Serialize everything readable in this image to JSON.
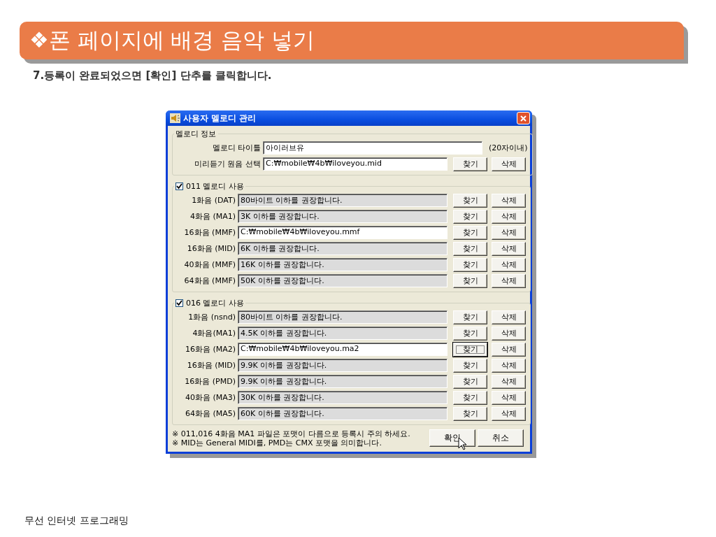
{
  "slide_title": "❖폰 페이지에 배경 음악 넣기",
  "instruction": "7.등록이 완료되었으면 [확인] 단추를 클릭합니다.",
  "dialog": {
    "title": "사용자 멜로디 관리",
    "info_group": {
      "legend": "멜로디 정보",
      "title_label": "멜로디 타이틀",
      "title_value": "아이러브유",
      "title_hint": "(20자이내)",
      "preview_label": "미리듣기 원음 선택",
      "preview_value": "C:₩mobile₩4b₩iloveyou.mid",
      "buttons": [
        "찾기",
        "삭제"
      ]
    },
    "groups": [
      {
        "legend": "011 멜로디 사용",
        "checked": true,
        "rows": [
          {
            "label": "1화음 (DAT)",
            "value": "80바이트 이하를 권장합니다.",
            "disabled": true,
            "buttons": [
              {
                "label": "찾기",
                "focused": false
              },
              {
                "label": "삭제",
                "focused": false
              }
            ]
          },
          {
            "label": "4화음 (MA1)",
            "value": "3K 이하를 권장합니다.",
            "disabled": true,
            "buttons": [
              {
                "label": "찾기",
                "focused": false
              },
              {
                "label": "삭제",
                "focused": false
              }
            ]
          },
          {
            "label": "16화음 (MMF)",
            "value": "C:₩mobile₩4b₩iloveyou.mmf",
            "disabled": false,
            "buttons": [
              {
                "label": "찾기",
                "focused": false
              },
              {
                "label": "삭제",
                "focused": false
              }
            ]
          },
          {
            "label": "16화음 (MID)",
            "value": "6K 이하를 권장합니다.",
            "disabled": true,
            "buttons": [
              {
                "label": "찾기",
                "focused": false
              },
              {
                "label": "삭제",
                "focused": false
              }
            ]
          },
          {
            "label": "40화음 (MMF)",
            "value": "16K 이하를 권장합니다.",
            "disabled": true,
            "buttons": [
              {
                "label": "찾기",
                "focused": false
              },
              {
                "label": "삭제",
                "focused": false
              }
            ]
          },
          {
            "label": "64화음 (MMF)",
            "value": "50K 이하를 권장합니다.",
            "disabled": true,
            "buttons": [
              {
                "label": "찾기",
                "focused": false
              },
              {
                "label": "삭제",
                "focused": false
              }
            ]
          }
        ]
      },
      {
        "legend": "016 멜로디 사용",
        "checked": true,
        "rows": [
          {
            "label": "1화음 (nsnd)",
            "value": "80바이트 이하를 권장합니다.",
            "disabled": true,
            "buttons": [
              {
                "label": "찾기",
                "focused": false
              },
              {
                "label": "삭제",
                "focused": false
              }
            ]
          },
          {
            "label": "4화음(MA1)",
            "value": "4.5K 이하를 권장합니다.",
            "disabled": true,
            "buttons": [
              {
                "label": "찾기",
                "focused": false
              },
              {
                "label": "삭제",
                "focused": false
              }
            ]
          },
          {
            "label": "16화음 (MA2)",
            "value": "C:₩mobile₩4b₩iloveyou.ma2",
            "disabled": false,
            "buttons": [
              {
                "label": "찾기",
                "focused": true
              },
              {
                "label": "삭제",
                "focused": false
              }
            ]
          },
          {
            "label": "16화음 (MID)",
            "value": "9.9K 이하를 권장합니다.",
            "disabled": true,
            "buttons": [
              {
                "label": "찾기",
                "focused": false
              },
              {
                "label": "삭제",
                "focused": false
              }
            ]
          },
          {
            "label": "16화음 (PMD)",
            "value": "9.9K 이하를 권장합니다.",
            "disabled": true,
            "buttons": [
              {
                "label": "찾기",
                "focused": false
              },
              {
                "label": "삭제",
                "focused": false
              }
            ]
          },
          {
            "label": "40화음 (MA3)",
            "value": "30K 이하를 권장합니다.",
            "disabled": true,
            "buttons": [
              {
                "label": "찾기",
                "focused": false
              },
              {
                "label": "삭제",
                "focused": false
              }
            ]
          },
          {
            "label": "64화음 (MA5)",
            "value": "60K 이하를 권장합니다.",
            "disabled": true,
            "buttons": [
              {
                "label": "찾기",
                "focused": false
              },
              {
                "label": "삭제",
                "focused": false
              }
            ]
          }
        ]
      }
    ],
    "notes": [
      "※ 011,016 4화음 MA1 파일은 포맷이 다름으로 등록시 주의 하세요.",
      "※ MID는 General MIDI를, PMD는 CMX 포맷을 의미합니다."
    ],
    "buttons": [
      "확인",
      "취소"
    ]
  },
  "footer": "무선 인터넷 프로그래밍"
}
